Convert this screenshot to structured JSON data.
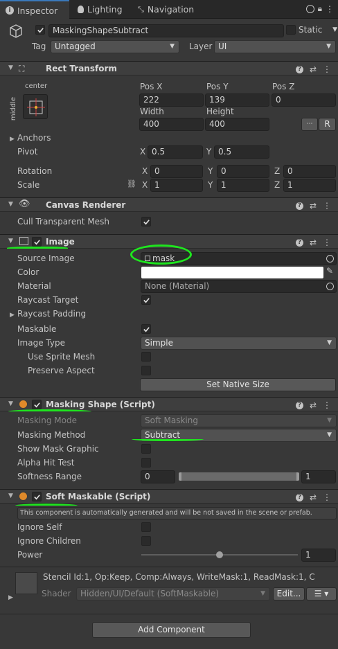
{
  "tabs": [
    {
      "label": "Inspector",
      "icon": "info-icon"
    },
    {
      "label": "Lighting",
      "icon": "bulb-icon"
    },
    {
      "label": "Navigation",
      "icon": "navigation-icon"
    }
  ],
  "header": {
    "object_name": "MaskingShapeSubtract",
    "static_label": "Static",
    "tag_label": "Tag",
    "tag_value": "Untagged",
    "layer_label": "Layer",
    "layer_value": "UI"
  },
  "rect_transform": {
    "title": "Rect Transform",
    "anchor_h": "center",
    "anchor_v": "middle",
    "pos_x_label": "Pos X",
    "pos_x": "222",
    "pos_y_label": "Pos Y",
    "pos_y": "139",
    "pos_z_label": "Pos Z",
    "pos_z": "0",
    "width_label": "Width",
    "width": "400",
    "height_label": "Height",
    "height": "400",
    "r_button": "R",
    "anchors_label": "Anchors",
    "pivot_label": "Pivot",
    "pivot_x": "0.5",
    "pivot_y": "0.5",
    "rotation_label": "Rotation",
    "rot_x": "0",
    "rot_y": "0",
    "rot_z": "0",
    "scale_label": "Scale",
    "scale_x": "1",
    "scale_y": "1",
    "scale_z": "1",
    "x": "X",
    "y": "Y",
    "z": "Z"
  },
  "canvas_renderer": {
    "title": "Canvas Renderer",
    "cull_label": "Cull Transparent Mesh"
  },
  "image": {
    "title": "Image",
    "source_label": "Source Image",
    "source_value": "mask",
    "color_label": "Color",
    "material_label": "Material",
    "material_value": "None (Material)",
    "raycast_target_label": "Raycast Target",
    "raycast_padding_label": "Raycast Padding",
    "maskable_label": "Maskable",
    "image_type_label": "Image Type",
    "image_type_value": "Simple",
    "use_sprite_mesh_label": "Use Sprite Mesh",
    "preserve_aspect_label": "Preserve Aspect",
    "set_native_size": "Set Native Size"
  },
  "masking_shape": {
    "title": "Masking Shape (Script)",
    "mode_label": "Masking Mode",
    "mode_value": "Soft Masking",
    "method_label": "Masking Method",
    "method_value": "Subtract",
    "show_graphic_label": "Show Mask Graphic",
    "alpha_hit_label": "Alpha Hit Test",
    "softness_label": "Softness Range",
    "softness_min": "0",
    "softness_max": "1"
  },
  "soft_maskable": {
    "title": "Soft Maskable (Script)",
    "notice": "This component is automatically generated and will be not saved in the scene or prefab.",
    "ignore_self_label": "Ignore Self",
    "ignore_children_label": "Ignore Children",
    "power_label": "Power",
    "power_value": "1",
    "power_slider": 0.5
  },
  "material_footer": {
    "stencil": "Stencil Id:1, Op:Keep, Comp:Always, WriteMask:1, ReadMask:1, C",
    "shader_label": "Shader",
    "shader_value": "Hidden/UI/Default (SoftMaskable)",
    "edit_button": "Edit..."
  },
  "add_component": "Add Component",
  "colors": {
    "annotation": "#1ee61e",
    "accent": "#3a79bb",
    "background": "#383838"
  }
}
